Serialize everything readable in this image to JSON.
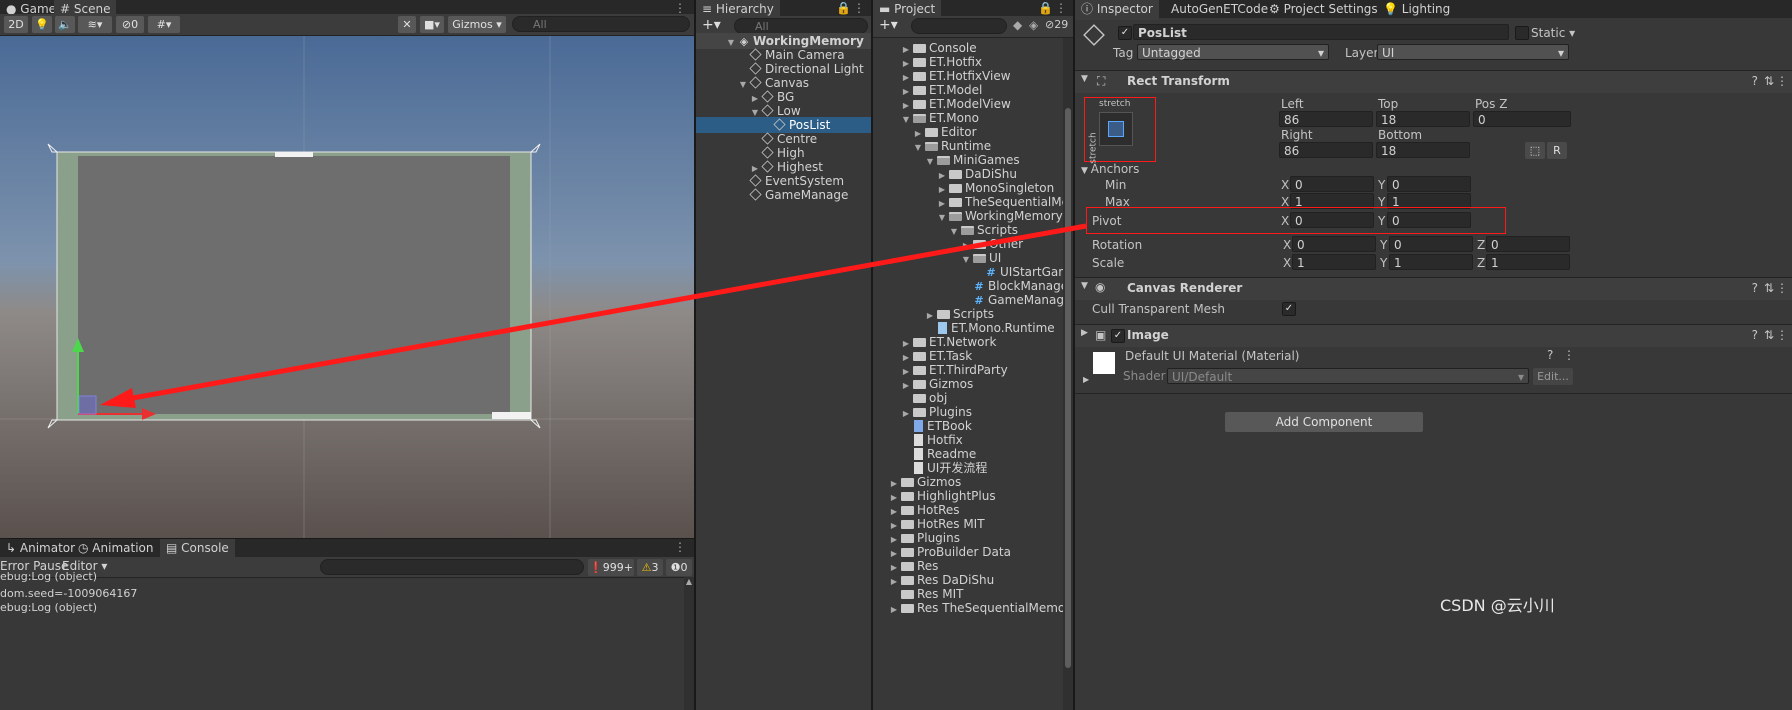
{
  "scene_panel": {
    "tabs": [
      "Game",
      "Scene"
    ],
    "toolbar": {
      "mode_2d": "2D",
      "hidden_count": "0",
      "gizmos": "Gizmos",
      "search_placeholder": "All"
    }
  },
  "console_panel": {
    "tabs": [
      "Animator",
      "Animation",
      "Console"
    ],
    "toolbar": {
      "error_pause": "Error Pause",
      "editor": "Editor",
      "log_count": "999+",
      "warn_count": "3",
      "error_count": "0"
    },
    "entries": [
      "ebug:Log (object)",
      "dom.seed=-1009064167",
      "ebug:Log (object)"
    ]
  },
  "hierarchy": {
    "tab": "Hierarchy",
    "search_placeholder": "All",
    "items": [
      {
        "label": "WorkingMemory",
        "depth": 0,
        "caret": "open",
        "icon": "unity-scene"
      },
      {
        "label": "Main Camera",
        "depth": 1,
        "caret": "none",
        "icon": "gameobject"
      },
      {
        "label": "Directional Light",
        "depth": 1,
        "caret": "none",
        "icon": "gameobject"
      },
      {
        "label": "Canvas",
        "depth": 1,
        "caret": "open",
        "icon": "gameobject"
      },
      {
        "label": "BG",
        "depth": 2,
        "caret": "closed",
        "icon": "gameobject"
      },
      {
        "label": "Low",
        "depth": 2,
        "caret": "open",
        "icon": "gameobject"
      },
      {
        "label": "PosList",
        "depth": 3,
        "caret": "none",
        "icon": "gameobject",
        "selected": true
      },
      {
        "label": "Centre",
        "depth": 2,
        "caret": "none",
        "icon": "gameobject"
      },
      {
        "label": "High",
        "depth": 2,
        "caret": "none",
        "icon": "gameobject"
      },
      {
        "label": "Highest",
        "depth": 2,
        "caret": "closed",
        "icon": "gameobject"
      },
      {
        "label": "EventSystem",
        "depth": 1,
        "caret": "none",
        "icon": "gameobject"
      },
      {
        "label": "GameManage",
        "depth": 1,
        "caret": "none",
        "icon": "gameobject"
      }
    ]
  },
  "project": {
    "tab": "Project",
    "hidden_count": "29",
    "items": [
      {
        "label": "Console",
        "depth": 1,
        "caret": "closed",
        "icon": "folder"
      },
      {
        "label": "ET.Hotfix",
        "depth": 1,
        "caret": "closed",
        "icon": "folder"
      },
      {
        "label": "ET.HotfixView",
        "depth": 1,
        "caret": "closed",
        "icon": "folder"
      },
      {
        "label": "ET.Model",
        "depth": 1,
        "caret": "closed",
        "icon": "folder"
      },
      {
        "label": "ET.ModelView",
        "depth": 1,
        "caret": "closed",
        "icon": "folder"
      },
      {
        "label": "ET.Mono",
        "depth": 1,
        "caret": "open",
        "icon": "folder-open"
      },
      {
        "label": "Editor",
        "depth": 2,
        "caret": "closed",
        "icon": "folder"
      },
      {
        "label": "Runtime",
        "depth": 2,
        "caret": "open",
        "icon": "folder-open"
      },
      {
        "label": "MiniGames",
        "depth": 3,
        "caret": "open",
        "icon": "folder-open"
      },
      {
        "label": "DaDiShu",
        "depth": 4,
        "caret": "closed",
        "icon": "folder"
      },
      {
        "label": "MonoSingleton",
        "depth": 4,
        "caret": "closed",
        "icon": "folder"
      },
      {
        "label": "TheSequentialMemo",
        "depth": 4,
        "caret": "closed",
        "icon": "folder"
      },
      {
        "label": "WorkingMemory",
        "depth": 4,
        "caret": "open",
        "icon": "folder-open"
      },
      {
        "label": "Scripts",
        "depth": 5,
        "caret": "open",
        "icon": "folder-open"
      },
      {
        "label": "Other",
        "depth": 6,
        "caret": "closed",
        "icon": "folder"
      },
      {
        "label": "UI",
        "depth": 6,
        "caret": "open",
        "icon": "folder-open"
      },
      {
        "label": "UIStartGame",
        "depth": 7,
        "caret": "none",
        "icon": "csharp"
      },
      {
        "label": "BlockManage",
        "depth": 6,
        "caret": "none",
        "icon": "csharp"
      },
      {
        "label": "GameManage",
        "depth": 6,
        "caret": "none",
        "icon": "csharp"
      },
      {
        "label": "Scripts",
        "depth": 3,
        "caret": "closed",
        "icon": "folder"
      },
      {
        "label": "ET.Mono.Runtime",
        "depth": 3,
        "caret": "none",
        "icon": "asmdef"
      },
      {
        "label": "ET.Network",
        "depth": 1,
        "caret": "closed",
        "icon": "folder"
      },
      {
        "label": "ET.Task",
        "depth": 1,
        "caret": "closed",
        "icon": "folder"
      },
      {
        "label": "ET.ThirdParty",
        "depth": 1,
        "caret": "closed",
        "icon": "folder"
      },
      {
        "label": "Gizmos",
        "depth": 1,
        "caret": "closed",
        "icon": "folder"
      },
      {
        "label": "obj",
        "depth": 1,
        "caret": "none",
        "icon": "folder"
      },
      {
        "label": "Plugins",
        "depth": 1,
        "caret": "closed",
        "icon": "folder"
      },
      {
        "label": "ETBook",
        "depth": 1,
        "caret": "none",
        "icon": "document-blue"
      },
      {
        "label": "Hotfix",
        "depth": 1,
        "caret": "none",
        "icon": "document"
      },
      {
        "label": "Readme",
        "depth": 1,
        "caret": "none",
        "icon": "document"
      },
      {
        "label": "UI开发流程",
        "depth": 1,
        "caret": "none",
        "icon": "document"
      },
      {
        "label": "Gizmos",
        "depth": 0,
        "caret": "closed",
        "icon": "folder"
      },
      {
        "label": "HighlightPlus",
        "depth": 0,
        "caret": "closed",
        "icon": "folder"
      },
      {
        "label": "HotRes",
        "depth": 0,
        "caret": "closed",
        "icon": "folder"
      },
      {
        "label": "HotRes MIT",
        "depth": 0,
        "caret": "closed",
        "icon": "folder"
      },
      {
        "label": "Plugins",
        "depth": 0,
        "caret": "closed",
        "icon": "folder"
      },
      {
        "label": "ProBuilder Data",
        "depth": 0,
        "caret": "closed",
        "icon": "folder"
      },
      {
        "label": "Res",
        "depth": 0,
        "caret": "closed",
        "icon": "folder"
      },
      {
        "label": "Res DaDiShu",
        "depth": 0,
        "caret": "closed",
        "icon": "folder"
      },
      {
        "label": "Res MIT",
        "depth": 0,
        "caret": "none",
        "icon": "folder"
      },
      {
        "label": "Res TheSequentialMemory",
        "depth": 0,
        "caret": "closed",
        "icon": "folder"
      }
    ]
  },
  "inspector": {
    "tabs": [
      "Inspector",
      "AutoGenETCode",
      "Project Settings",
      "Lighting"
    ],
    "object_name": "PosList",
    "static_label": "Static",
    "tag_label": "Tag",
    "tag_value": "Untagged",
    "layer_label": "Layer",
    "layer_value": "UI",
    "rect_transform": {
      "title": "Rect Transform",
      "anchor_preset_top": "stretch",
      "anchor_preset_side": "stretch",
      "left_label": "Left",
      "left": "86",
      "top_label": "Top",
      "top": "18",
      "posz_label": "Pos Z",
      "posz": "0",
      "right_label": "Right",
      "right": "86",
      "bottom_label": "Bottom",
      "bottom": "18",
      "r_button": "R",
      "anchors_label": "Anchors",
      "min_label": "Min",
      "min_x": "0",
      "min_y": "0",
      "max_label": "Max",
      "max_x": "1",
      "max_y": "1",
      "pivot_label": "Pivot",
      "pivot_x": "0",
      "pivot_y": "0",
      "rotation_label": "Rotation",
      "rot_x": "0",
      "rot_y": "0",
      "rot_z": "0",
      "scale_label": "Scale",
      "scale_x": "1",
      "scale_y": "1",
      "scale_z": "1",
      "x": "X",
      "y": "Y",
      "z": "Z"
    },
    "canvas_renderer": {
      "title": "Canvas Renderer",
      "cull_label": "Cull Transparent Mesh",
      "cull_checked": true
    },
    "image": {
      "title": "Image",
      "material": "Default UI Material (Material)",
      "shader_label": "Shader",
      "shader_value": "UI/Default",
      "edit_button": "Edit..."
    },
    "add_component": "Add Component"
  },
  "watermark": "CSDN @云小川",
  "colors": {
    "accent_blue": "#3a79bb",
    "selection": "#2c5d87",
    "highlight_red": "#ff1a1a",
    "scene_canvas": "#6e6e6e",
    "canvas_border": "#8aa08a"
  }
}
